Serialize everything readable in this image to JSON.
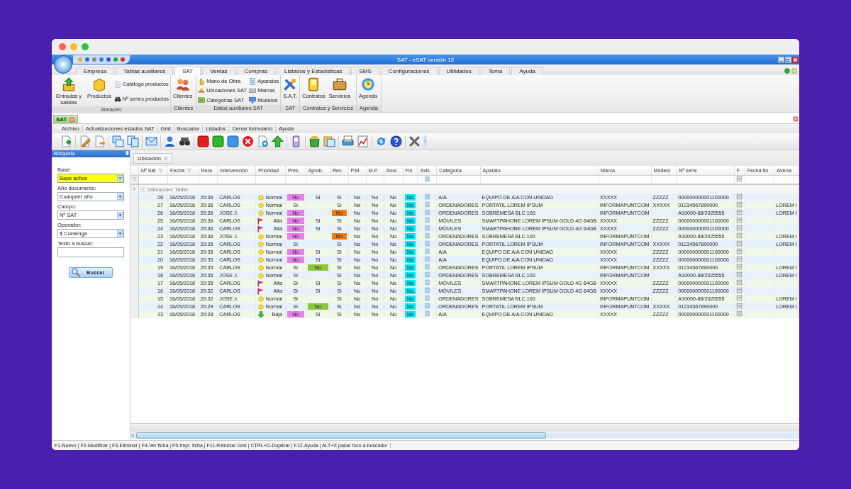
{
  "app": {
    "title": "SAT - eSAT versión 12"
  },
  "ribbon_tabs": [
    {
      "label": "Empresa",
      "selected": false
    },
    {
      "label": "Tablas auxiliares",
      "selected": false
    },
    {
      "label": "SAT",
      "selected": true
    },
    {
      "label": "Ventas",
      "selected": false
    },
    {
      "label": "Compras",
      "selected": false
    },
    {
      "label": "Listados y Estadísticas",
      "selected": false
    },
    {
      "label": "SMS",
      "selected": false
    },
    {
      "label": "Configuraciones",
      "selected": false
    },
    {
      "label": "Utilidades",
      "selected": false
    },
    {
      "label": "Tema",
      "selected": false
    },
    {
      "label": "Ayuda",
      "selected": false
    }
  ],
  "ribbon_groups": [
    {
      "label": "Almacén",
      "items": [
        {
          "label": "Entradas y salidas",
          "kind": "large"
        },
        {
          "label": "Productos",
          "kind": "large"
        },
        {
          "label": "Catálogo productos",
          "kind": "small"
        },
        {
          "label": "Nº series productos",
          "kind": "small"
        }
      ]
    },
    {
      "label": "Clientes",
      "items": [
        {
          "label": "Clientes",
          "kind": "large"
        }
      ]
    },
    {
      "label": "Datos auxiliares SAT",
      "items": [
        {
          "label": "Mano de Obra",
          "kind": "small"
        },
        {
          "label": "Ubicaciones SAT",
          "kind": "small"
        },
        {
          "label": "Categorías SAT",
          "kind": "small"
        },
        {
          "label": "Aparatos",
          "kind": "small"
        },
        {
          "label": "Marcas",
          "kind": "small"
        },
        {
          "label": "Modelos",
          "kind": "small"
        }
      ]
    },
    {
      "label": "SAT",
      "items": [
        {
          "label": "S.A.T.",
          "kind": "large"
        }
      ]
    },
    {
      "label": "Contratos y Servicios",
      "items": [
        {
          "label": "Contratos",
          "kind": "large"
        },
        {
          "label": "Servicios",
          "kind": "large"
        }
      ]
    },
    {
      "label": "Agenda",
      "items": [
        {
          "label": "Agenda",
          "kind": "large"
        }
      ]
    }
  ],
  "doc_tabs": [
    {
      "label": "SAT",
      "selected": true
    }
  ],
  "menu": [
    "Archivo",
    "Actualizaciones estados SAT",
    "Grid",
    "Buscador",
    "Listados",
    "Cerrar formulario",
    "Ayuda"
  ],
  "sidebar": {
    "title": "Búsqueda",
    "fields": [
      {
        "label": "Base:",
        "value": "Base activa",
        "kind": "select",
        "highlighted": true
      },
      {
        "label": "Año documento:",
        "value": "Cualquier año",
        "kind": "select",
        "highlighted": false
      },
      {
        "label": "Campo:",
        "value": "Nº SAT",
        "kind": "select",
        "highlighted": false
      },
      {
        "label": "Operador:",
        "value": "$ Contenga",
        "kind": "select",
        "highlighted": false
      },
      {
        "label": "Texto a buscar:",
        "kind": "text",
        "highlighted": false
      }
    ],
    "button": "Buscar"
  },
  "grid": {
    "group_by": [
      {
        "label": "Ubicación"
      }
    ],
    "columns": [
      {
        "label": "Nº Sat",
        "filter_icon": true
      },
      {
        "label": "Fecha",
        "filter_icon": true
      },
      {
        "label": "Hora",
        "filter_icon": false
      },
      {
        "label": "Intervención",
        "filter_icon": false
      },
      {
        "label": "Prioridad",
        "filter_icon": false
      },
      {
        "label": "Pres.",
        "filter_icon": false
      },
      {
        "label": "Aprob.",
        "filter_icon": false
      },
      {
        "label": "Rev.",
        "filter_icon": false
      },
      {
        "label": "P.M.",
        "filter_icon": false
      },
      {
        "label": "M.P.",
        "filter_icon": false
      },
      {
        "label": "Anul.",
        "filter_icon": false
      },
      {
        "label": "Fin",
        "filter_icon": false
      },
      {
        "label": "Avis.",
        "filter_icon": false
      },
      {
        "label": "Categoría",
        "filter_icon": false
      },
      {
        "label": "Aparato",
        "filter_icon": false
      },
      {
        "label": "Marca",
        "filter_icon": false
      },
      {
        "label": "Modelo",
        "filter_icon": false
      },
      {
        "label": "Nº serie",
        "filter_icon": false
      },
      {
        "label": "F",
        "filter_icon": false
      },
      {
        "label": "Fecha fin",
        "filter_icon": false
      },
      {
        "label": "Avería",
        "filter_icon": false
      }
    ],
    "group": {
      "label": "Ubicación: Taller",
      "expanded": true
    },
    "rows": [
      {
        "n_sat": "28",
        "fecha": "16/05/2018",
        "hora": "20:36",
        "intervencion": "CARLOS",
        "prioridad": {
          "label": "Normal",
          "kind": "normal"
        },
        "pres": {
          "text": "No",
          "color": "#e880e6"
        },
        "aprob": "Si",
        "rev": "Si",
        "pm": "No",
        "mp": "No",
        "anul": "No",
        "fin": {
          "text": "No",
          "color": "#00e8f0"
        },
        "categoria": "A/A",
        "aparato": "EQUIPO DE A/A CON UNIDAD",
        "marca": "XXXXX",
        "modelo": "ZZZZZ",
        "n_serie": "000000000001100000"
      },
      {
        "n_sat": "27",
        "fecha": "16/05/2018",
        "hora": "20:36",
        "intervencion": "CARLOS",
        "prioridad": {
          "label": "Normal",
          "kind": "normal"
        },
        "pres": "Si",
        "rev": "Si",
        "pm": "No",
        "mp": "No",
        "anul": "No",
        "fin": {
          "text": "No",
          "color": "#00e8f0"
        },
        "categoria": "ORDENADORES",
        "aparato": "PORTATIL LOREM IPSUM",
        "marca": "INFORMAPUNTCOM",
        "modelo": "XXXXX",
        "n_serie": "01234567890000",
        "averia": "LOREM I"
      },
      {
        "n_sat": "26",
        "fecha": "16/05/2018",
        "hora": "20:36",
        "intervencion": "JOSE J.",
        "prioridad": {
          "label": "Normal",
          "kind": "normal"
        },
        "pres": {
          "text": "No",
          "color": "#e880e6"
        },
        "rev": {
          "text": "No",
          "color": "#f07a10"
        },
        "pm": "No",
        "mp": "No",
        "anul": "No",
        "fin": {
          "text": "No",
          "color": "#00e8f0"
        },
        "categoria": "ORDENADORES",
        "aparato": "SOBREMESA BLC.100",
        "marca": "INFORMAPUNTCOM",
        "n_serie": "A10000-88/2025555",
        "averia": "LOREM I"
      },
      {
        "n_sat": "25",
        "fecha": "16/05/2018",
        "hora": "20:36",
        "intervencion": "CARLOS",
        "prioridad": {
          "label": "Alta",
          "kind": "alta"
        },
        "pres": {
          "text": "No",
          "color": "#e880e6"
        },
        "aprob": "Si",
        "rev": "Si",
        "pm": "No",
        "mp": "No",
        "anul": "No",
        "fin": {
          "text": "No",
          "color": "#00e8f0"
        },
        "categoria": "MÓVILES",
        "aparato": "SMARTPAHONE LOREM IPSUM GOLD 4G 64GB",
        "marca": "XXXXX",
        "modelo": "ZZZZZ",
        "n_serie": "000000000001100000"
      },
      {
        "n_sat": "24",
        "fecha": "16/05/2018",
        "hora": "20:36",
        "intervencion": "CARLOS",
        "prioridad": {
          "label": "Alta",
          "kind": "alta"
        },
        "pres": {
          "text": "No",
          "color": "#e880e6"
        },
        "aprob": "Si",
        "rev": "Si",
        "pm": "No",
        "mp": "No",
        "anul": "No",
        "fin": {
          "text": "No",
          "color": "#00e8f0"
        },
        "categoria": "MÓVILES",
        "aparato": "SMARTPAHONE LOREM IPSUM GOLD 4G 64GB",
        "marca": "XXXXX",
        "modelo": "ZZZZZ",
        "n_serie": "000000000001100000"
      },
      {
        "n_sat": "23",
        "fecha": "16/05/2018",
        "hora": "20:36",
        "intervencion": "JOSE J.",
        "prioridad": {
          "label": "Normal",
          "kind": "normal"
        },
        "pres": {
          "text": "No",
          "color": "#e880e6"
        },
        "rev": {
          "text": "No",
          "color": "#f07a10"
        },
        "pm": "No",
        "mp": "No",
        "anul": "No",
        "fin": {
          "text": "No",
          "color": "#00e8f0"
        },
        "categoria": "ORDENADORES",
        "aparato": "SOBREMESA BLC.100",
        "marca": "INFORMAPUNTCOM",
        "n_serie": "A10000-88/2025555",
        "averia": "LOREM I"
      },
      {
        "n_sat": "22",
        "fecha": "16/05/2018",
        "hora": "20:35",
        "intervencion": "CARLOS",
        "prioridad": {
          "label": "Normal",
          "kind": "normal"
        },
        "pres": "Si",
        "rev": "Si",
        "pm": "No",
        "mp": "No",
        "anul": "No",
        "fin": {
          "text": "No",
          "color": "#00e8f0"
        },
        "categoria": "ORDENADORES",
        "aparato": "PORTATIL LOREM IPSUM",
        "marca": "INFORMAPUNTCOM",
        "modelo": "XXXXX",
        "n_serie": "01234567890000",
        "averia": "LOREM I"
      },
      {
        "n_sat": "21",
        "fecha": "16/05/2018",
        "hora": "20:35",
        "intervencion": "CARLOS",
        "prioridad": {
          "label": "Normal",
          "kind": "normal"
        },
        "pres": {
          "text": "No",
          "color": "#e880e6"
        },
        "aprob": "Si",
        "rev": "Si",
        "pm": "No",
        "mp": "No",
        "anul": "No",
        "fin": {
          "text": "No",
          "color": "#00e8f0"
        },
        "categoria": "A/A",
        "aparato": "EQUIPO DE A/A CON UNIDAD",
        "marca": "XXXXX",
        "modelo": "ZZZZZ",
        "n_serie": "000000000001100000"
      },
      {
        "n_sat": "20",
        "fecha": "16/05/2018",
        "hora": "20:35",
        "intervencion": "CARLOS",
        "prioridad": {
          "label": "Normal",
          "kind": "normal"
        },
        "pres": {
          "text": "No",
          "color": "#e880e6"
        },
        "aprob": "Si",
        "rev": "Si",
        "pm": "No",
        "mp": "No",
        "anul": "No",
        "fin": {
          "text": "No",
          "color": "#00e8f0"
        },
        "categoria": "A/A",
        "aparato": "EQUIPO DE A/A CON UNIDAD",
        "marca": "XXXXX",
        "modelo": "ZZZZZ",
        "n_serie": "000000000001100000"
      },
      {
        "n_sat": "19",
        "fecha": "16/05/2018",
        "hora": "20:35",
        "intervencion": "CARLOS",
        "prioridad": {
          "label": "Normal",
          "kind": "normal"
        },
        "pres": "Si",
        "aprob": {
          "text": "No",
          "color": "#8cc43c"
        },
        "rev": "Si",
        "pm": "No",
        "mp": "No",
        "anul": "No",
        "fin": {
          "text": "No",
          "color": "#00e8f0"
        },
        "categoria": "ORDENADORES",
        "aparato": "PORTATIL LOREM IPSUM",
        "marca": "INFORMAPUNTCOM",
        "modelo": "XXXXX",
        "n_serie": "01234567890000",
        "averia": "LOREM I"
      },
      {
        "n_sat": "18",
        "fecha": "16/05/2018",
        "hora": "20:35",
        "intervencion": "JOSE J.",
        "prioridad": {
          "label": "Normal",
          "kind": "normal"
        },
        "pres": "Si",
        "rev": "Si",
        "pm": "No",
        "mp": "No",
        "anul": "No",
        "fin": {
          "text": "No",
          "color": "#00e8f0"
        },
        "categoria": "ORDENADORES",
        "aparato": "SOBREMESA BLC.100",
        "marca": "INFORMAPUNTCOM",
        "n_serie": "A10000-88/2025555",
        "averia": "LOREM I"
      },
      {
        "n_sat": "17",
        "fecha": "16/05/2018",
        "hora": "20:35",
        "intervencion": "CARLOS",
        "prioridad": {
          "label": "Alta",
          "kind": "alta"
        },
        "pres": "Si",
        "aprob": "Si",
        "rev": "Si",
        "pm": "No",
        "mp": "No",
        "anul": "No",
        "fin": {
          "text": "No",
          "color": "#00e8f0"
        },
        "categoria": "MÓVILES",
        "aparato": "SMARTPAHONE LOREM IPSUM GOLD 4G 64GB",
        "marca": "XXXXX",
        "modelo": "ZZZZZ",
        "n_serie": "000000000001100000"
      },
      {
        "n_sat": "16",
        "fecha": "16/05/2018",
        "hora": "20:32",
        "intervencion": "CARLOS",
        "prioridad": {
          "label": "Alta",
          "kind": "alta"
        },
        "pres": "Si",
        "aprob": "Si",
        "rev": "Si",
        "pm": "No",
        "mp": "No",
        "anul": "No",
        "fin": {
          "text": "No",
          "color": "#00e8f0"
        },
        "categoria": "MÓVILES",
        "aparato": "SMARTPAHONE LOREM IPSUM GOLD 4G 64GB",
        "marca": "XXXXX",
        "modelo": "ZZZZZ",
        "n_serie": "000000000001100000"
      },
      {
        "n_sat": "15",
        "fecha": "16/05/2018",
        "hora": "20:32",
        "intervencion": "JOSE J.",
        "prioridad": {
          "label": "Normal",
          "kind": "normal"
        },
        "pres": "Si",
        "rev": "Si",
        "pm": "No",
        "mp": "No",
        "anul": "No",
        "fin": {
          "text": "No",
          "color": "#00e8f0"
        },
        "categoria": "ORDENADORES",
        "aparato": "SOBREMESA BLC.100",
        "marca": "INFORMAPUNTCOM",
        "n_serie": "A10000-88/2025555",
        "averia": "LOREM I"
      },
      {
        "n_sat": "14",
        "fecha": "16/05/2018",
        "hora": "20:29",
        "intervencion": "CARLOS",
        "prioridad": {
          "label": "Normal",
          "kind": "normal"
        },
        "pres": "Si",
        "aprob": {
          "text": "No",
          "color": "#8cc43c"
        },
        "rev": "Si",
        "pm": "No",
        "mp": "No",
        "anul": "No",
        "fin": {
          "text": "No",
          "color": "#00e8f0"
        },
        "categoria": "ORDENADORES",
        "aparato": "PORTATIL LOREM IPSUM",
        "marca": "INFORMAPUNTCOM",
        "modelo": "XXXXX",
        "n_serie": "01234567890000",
        "averia": "LOREM I"
      },
      {
        "n_sat": "13",
        "fecha": "16/05/2018",
        "hora": "20:28",
        "intervencion": "CARLOS",
        "prioridad": {
          "label": "Baja",
          "kind": "baja"
        },
        "pres": {
          "text": "No",
          "color": "#e880e6"
        },
        "aprob": "Si",
        "rev": "Si",
        "pm": "No",
        "mp": "No",
        "anul": "No",
        "fin": {
          "text": "No",
          "color": "#00e8f0"
        },
        "categoria": "A/A",
        "aparato": "EQUIPO DE A/A CON UNIDAD",
        "marca": "XXXXX",
        "modelo": "ZZZZZ",
        "n_serie": "000000000001100000"
      }
    ]
  },
  "status_bar": "F1-Nuevo | F2-Modificar | F3-Eliminar | F4-Ver ficha | F5-Impr. ficha | F11-Reiniciar Grid | CTRL+D-Duplicar | F12-Ayuda | ALT+X pasar foco a buscador"
}
